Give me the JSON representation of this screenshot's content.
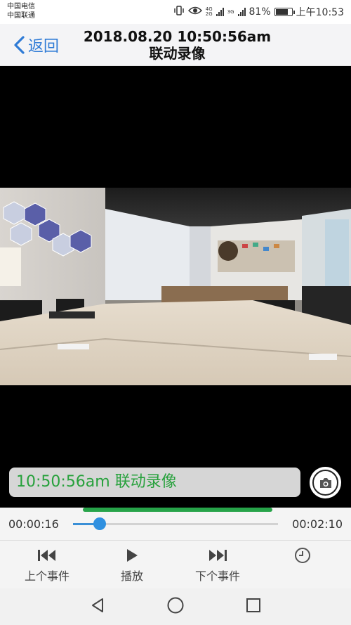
{
  "status_bar": {
    "carrier1": "中国电信",
    "carrier2": "中国联通",
    "net1": "4G",
    "net1b": "2G",
    "net2": "3G",
    "battery": "81%",
    "battery_level": 0.81,
    "time": "上午10:53"
  },
  "header": {
    "back_label": "返回",
    "title_line1": "2018.08.20 10:50:56am",
    "title_line2": "联动录像"
  },
  "caption": {
    "text": "10:50:56am 联动录像"
  },
  "playback": {
    "current_time": "00:00:16",
    "total_time": "00:02:10",
    "progress": 0.13
  },
  "controls": {
    "prev_label": "上个事件",
    "play_label": "播放",
    "next_label": "下个事件"
  },
  "colors": {
    "accent_blue": "#2f7bd6",
    "caption_green": "#27a13c",
    "buffer_green": "#27a349",
    "thumb_blue": "#2f90e0"
  },
  "icons": {
    "back": "chevron-left-icon",
    "camera": "camera-icon",
    "prev": "skip-previous-icon",
    "play": "play-icon",
    "next": "skip-next-icon",
    "history": "clock-icon",
    "nav_back": "triangle-back-icon",
    "nav_home": "circle-home-icon",
    "nav_recent": "square-recent-icon"
  }
}
